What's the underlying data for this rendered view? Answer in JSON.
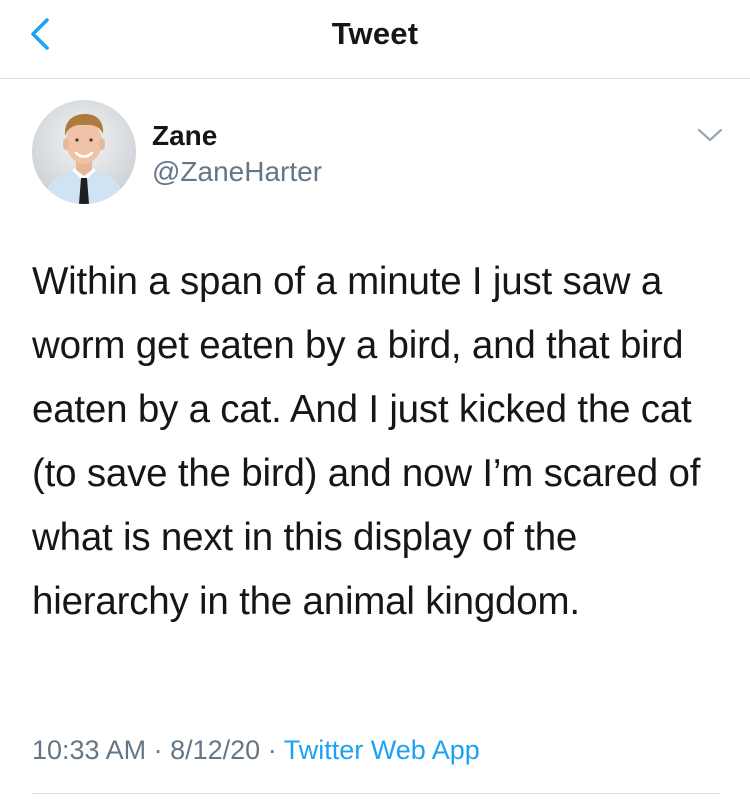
{
  "nav": {
    "title": "Tweet",
    "back_icon": "chevron-left-icon"
  },
  "author": {
    "display_name": "Zane",
    "handle": "@ZaneHarter",
    "menu_icon": "chevron-down-icon"
  },
  "tweet": {
    "text": "Within a span of a minute I just saw a worm get eaten by a bird, and that bird eaten by a cat. And I just kicked the cat (to save the bird) and now I’m scared of what is next in this display of the hierarchy in the animal kingdom.",
    "time": "10:33 AM",
    "date": "8/12/20",
    "separator": "·",
    "source": "Twitter Web App"
  },
  "colors": {
    "accent": "#1da1f2",
    "secondary_text": "#657786",
    "primary_text": "#14171a",
    "divider": "#d7dbdf"
  }
}
